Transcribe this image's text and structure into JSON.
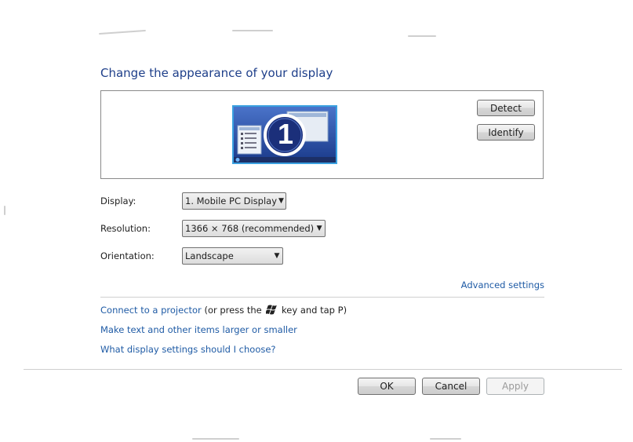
{
  "page": {
    "title": "Change the appearance of your display"
  },
  "preview": {
    "monitor_number": "1",
    "detect_label": "Detect",
    "identify_label": "Identify"
  },
  "fields": {
    "display_label": "Display:",
    "display_value": "1. Mobile PC Display",
    "resolution_label": "Resolution:",
    "resolution_value": "1366 × 768 (recommended)",
    "orientation_label": "Orientation:",
    "orientation_value": "Landscape"
  },
  "links": {
    "advanced_settings": "Advanced settings",
    "connect_projector": "Connect to a projector",
    "connect_projector_hint_pre": "(or press the",
    "connect_projector_hint_post": "key and tap P)",
    "text_size": "Make text and other items larger or smaller",
    "display_help": "What display settings should I choose?"
  },
  "buttons": {
    "ok": "OK",
    "cancel": "Cancel",
    "apply": "Apply"
  },
  "icons": {
    "windows_key": "windows-logo-icon",
    "dropdown": "chevron-down-icon"
  },
  "colors": {
    "title": "#1e3f8a",
    "link": "#1f5ba5",
    "monitor_border": "#3aa0e0",
    "monitor_bg": "#1b3f8f"
  }
}
